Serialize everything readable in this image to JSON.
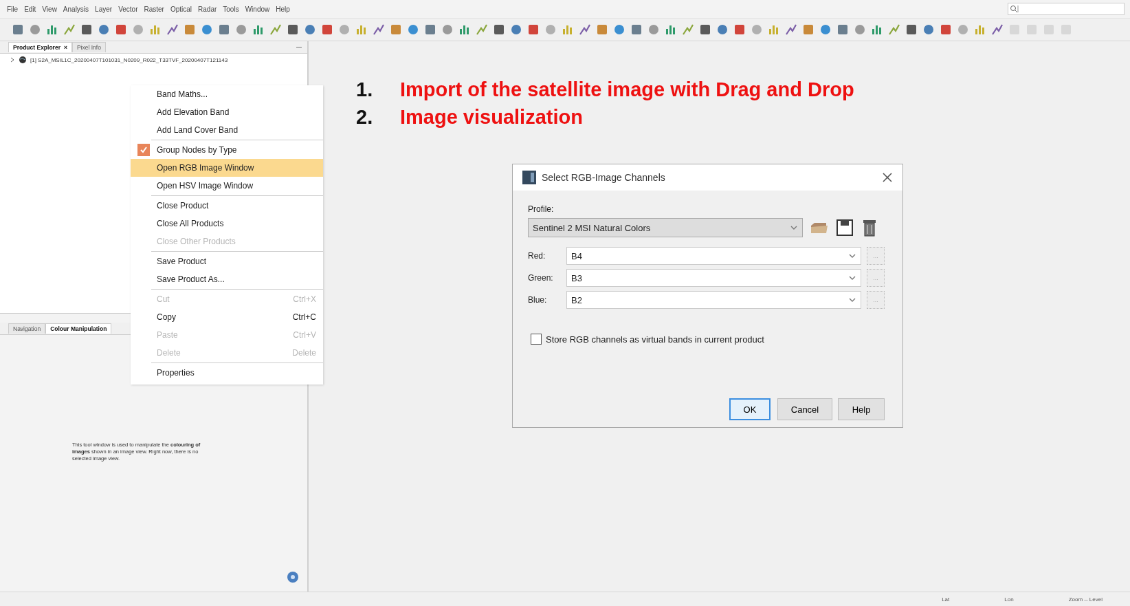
{
  "menu_bar": [
    "File",
    "Edit",
    "View",
    "Analysis",
    "Layer",
    "Vector",
    "Raster",
    "Optical",
    "Radar",
    "Tools",
    "Window",
    "Help"
  ],
  "product_explorer": {
    "tabs": [
      {
        "label": "Product Explorer",
        "selected": true,
        "close": "×"
      },
      {
        "label": "Pixel Info",
        "selected": false
      }
    ],
    "tree": [
      {
        "label": "[1] S2A_MSIL1C_20200407T101031_N0209_R022_T33TVF_20200407T121143",
        "expanded": false
      }
    ]
  },
  "tool_panel": {
    "tabs": [
      {
        "label": "Navigation",
        "selected": false
      },
      {
        "label": "Colour Manipulation",
        "selected": true
      }
    ],
    "message": "This tool window is used to manipulate the **colouring of images** shown in an image view. Right now, there is no selected image view."
  },
  "context_menu": {
    "items": [
      {
        "kind": "item",
        "label": "Band Maths...",
        "disabled": false,
        "checked": false,
        "selected": false
      },
      {
        "kind": "item",
        "label": "Add Elevation Band",
        "disabled": false,
        "checked": false,
        "selected": false
      },
      {
        "kind": "item",
        "label": "Add Land Cover Band",
        "disabled": false,
        "checked": false,
        "selected": false
      },
      {
        "kind": "separator"
      },
      {
        "kind": "item",
        "label": "Group Nodes by Type",
        "disabled": false,
        "checked": true,
        "selected": false
      },
      {
        "kind": "item",
        "label": "Open RGB Image Window",
        "disabled": false,
        "checked": false,
        "selected": true
      },
      {
        "kind": "item",
        "label": "Open HSV Image Window",
        "disabled": false,
        "checked": false,
        "selected": false
      },
      {
        "kind": "separator"
      },
      {
        "kind": "item",
        "label": "Close Product",
        "disabled": false,
        "checked": false,
        "selected": false
      },
      {
        "kind": "item",
        "label": "Close All Products",
        "disabled": false,
        "checked": false,
        "selected": false
      },
      {
        "kind": "item",
        "label": "Close Other Products",
        "disabled": true,
        "checked": false,
        "selected": false
      },
      {
        "kind": "separator"
      },
      {
        "kind": "item",
        "label": "Save Product",
        "disabled": false,
        "checked": false,
        "selected": false
      },
      {
        "kind": "item",
        "label": "Save Product As...",
        "disabled": false,
        "checked": false,
        "selected": false
      },
      {
        "kind": "separator"
      },
      {
        "kind": "item",
        "label": "Cut",
        "shortcut": "Ctrl+X",
        "disabled": true,
        "checked": false,
        "selected": false
      },
      {
        "kind": "item",
        "label": "Copy",
        "shortcut": "Ctrl+C",
        "disabled": false,
        "checked": false,
        "selected": false
      },
      {
        "kind": "item",
        "label": "Paste",
        "shortcut": "Ctrl+V",
        "disabled": true,
        "checked": false,
        "selected": false
      },
      {
        "kind": "item",
        "label": "Delete",
        "shortcut": "Delete",
        "disabled": true,
        "checked": false,
        "selected": false
      },
      {
        "kind": "separator"
      },
      {
        "kind": "item",
        "label": "Properties",
        "disabled": false,
        "checked": false,
        "selected": false
      }
    ]
  },
  "annotations": [
    {
      "number": "1.",
      "text": "Import of the satellite image with Drag and Drop"
    },
    {
      "number": "2.",
      "text": "Image visualization"
    }
  ],
  "dialog": {
    "title": "Select RGB-Image Channels",
    "profile_label": "Profile:",
    "profile_value": "Sentinel 2 MSI Natural Colors",
    "channels": [
      {
        "label": "Red:",
        "value": "B4",
        "browse": "..."
      },
      {
        "label": "Green:",
        "value": "B3",
        "browse": "..."
      },
      {
        "label": "Blue:",
        "value": "B2",
        "browse": "..."
      }
    ],
    "store_option": {
      "label": "Store RGB channels as virtual bands in current product",
      "checked": false
    },
    "buttons": [
      {
        "label": "OK",
        "default": true
      },
      {
        "label": "Cancel",
        "default": false
      },
      {
        "label": "Help",
        "default": false
      }
    ]
  },
  "status_bar": [
    "Lat",
    "Lon",
    "Zoom -- Level"
  ]
}
